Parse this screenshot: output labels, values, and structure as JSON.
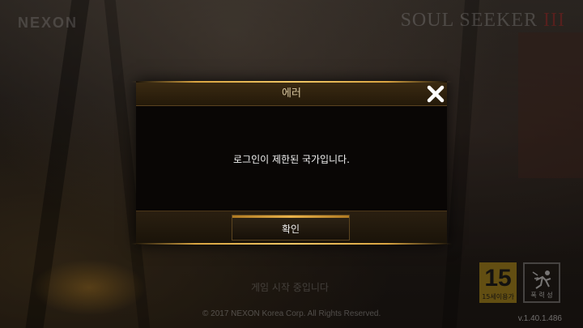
{
  "background": {
    "nexon_logo": "NEXON",
    "game_logo": "SOUL SEEKER",
    "game_logo_mark": "III",
    "faint_text": "게임 시작 중입니다",
    "copyright": "© 2017 NEXON Korea Corp. All Rights Reserved.",
    "version": "v.1.40.1.486",
    "rating_badge": {
      "number": "15",
      "label": "15세이용가"
    },
    "violence_badge": {
      "label": "폭 력 성"
    }
  },
  "dialog": {
    "title": "에러",
    "message": "로그인이 제한된 국가입니다.",
    "ok_label": "확인",
    "close_icon": "close-x-icon",
    "colors": {
      "accent": "#e9b24a",
      "title_text": "#d9c7a0",
      "panel": "#090605"
    }
  }
}
